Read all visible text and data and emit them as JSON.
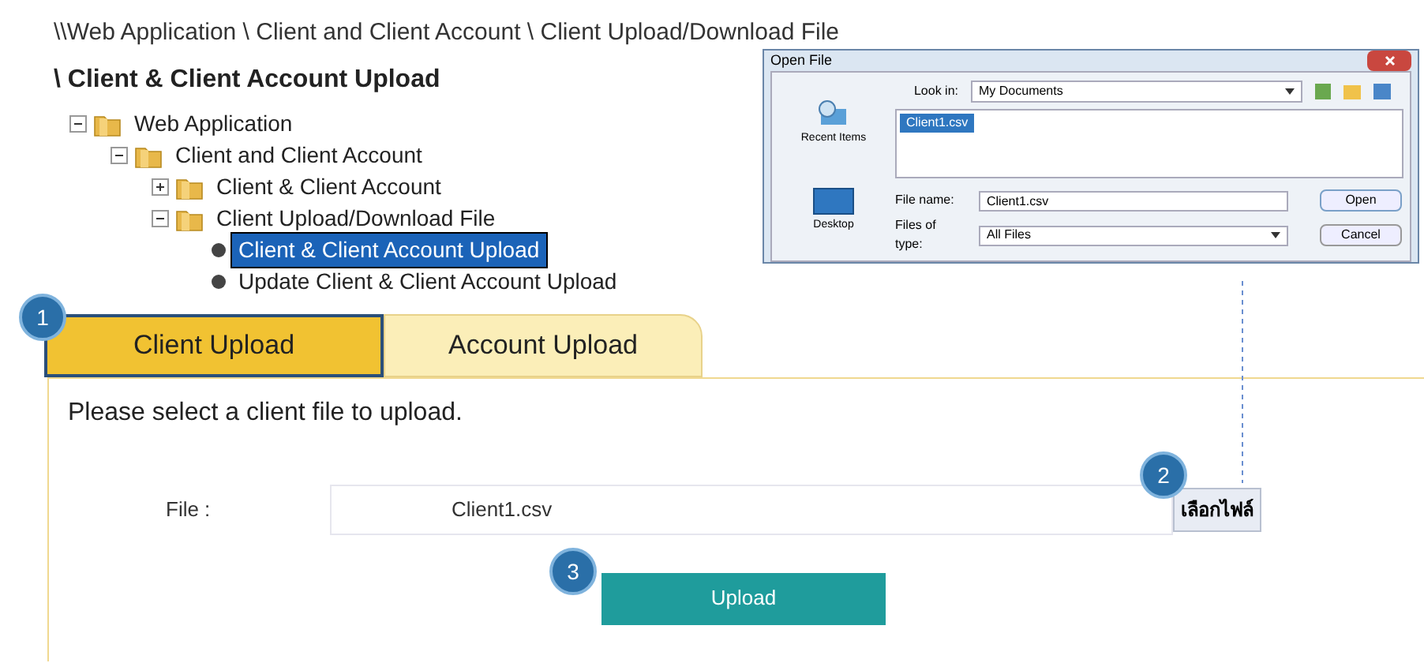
{
  "breadcrumb": {
    "path": "\\\\Web Application \\ Client and Client Account \\ Client Upload/Download File",
    "current": "\\ Client & Client Account Upload"
  },
  "tree": [
    {
      "label": "Web Application",
      "kind": "folder",
      "expanded": true,
      "selected": false,
      "children": [
        {
          "label": "Client and Client Account",
          "kind": "folder",
          "expanded": true,
          "selected": false,
          "children": [
            {
              "label": "Client & Client Account",
              "kind": "folder",
              "expanded": false,
              "selected": false
            },
            {
              "label": "Client Upload/Download File",
              "kind": "folder",
              "expanded": true,
              "selected": false,
              "children": [
                {
                  "label": "Client & Client Account Upload",
                  "kind": "leaf",
                  "selected": true
                },
                {
                  "label": "Update Client & Client Account Upload",
                  "kind": "leaf",
                  "selected": false
                }
              ]
            }
          ]
        }
      ]
    }
  ],
  "dialog": {
    "title": "Open File",
    "look_in_label": "Look in:",
    "look_in_value": "My Documents",
    "files": [
      {
        "name": "Client1.csv",
        "selected": true
      }
    ],
    "places": [
      "Recent Items",
      "Desktop"
    ],
    "file_name_label": "File name:",
    "file_name_value": "Client1.csv",
    "file_type_label": "Files of type:",
    "file_type_value": "All Files",
    "buttons": [
      "Open",
      "Cancel"
    ]
  },
  "steps": [
    "1",
    "2",
    "3"
  ],
  "tabs": [
    {
      "label": "Client Upload",
      "selected": true
    },
    {
      "label": "Account Upload",
      "selected": false
    }
  ],
  "panel": {
    "instruction": "Please select a client file to upload.",
    "file_label": "File :",
    "file_value": "Client1.csv",
    "browse_button": "เลือกไฟล์",
    "upload_button": "Upload"
  }
}
